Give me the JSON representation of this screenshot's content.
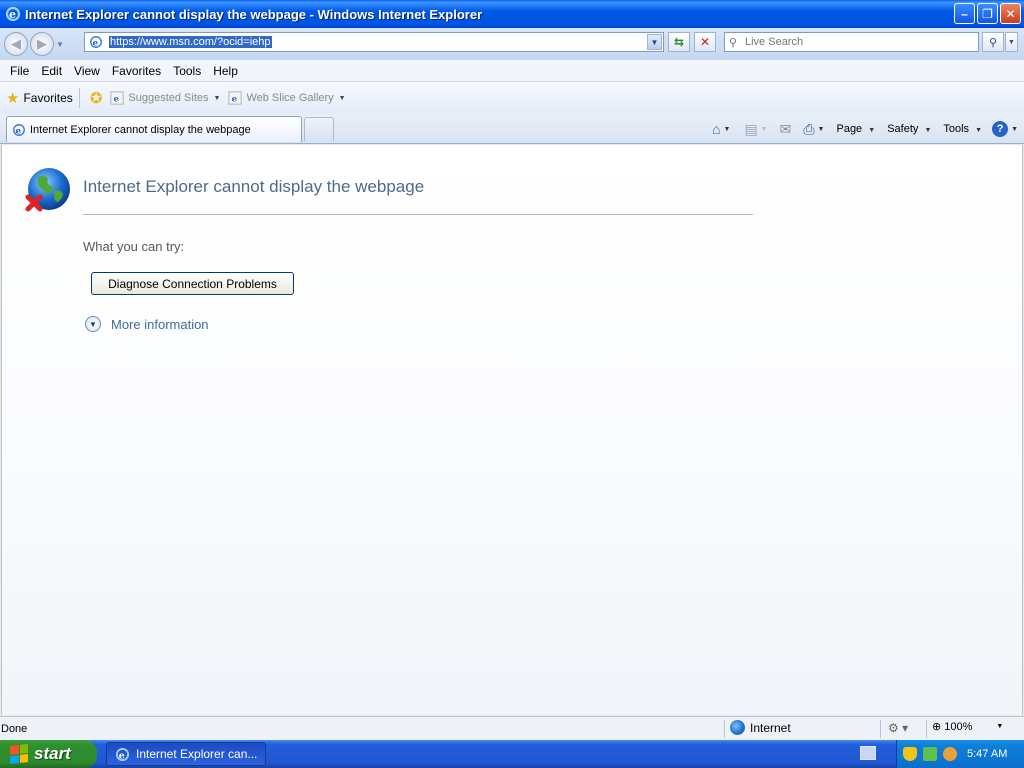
{
  "window": {
    "title": "Internet Explorer cannot display the webpage - Windows Internet Explorer",
    "controls": {
      "minimize": "–",
      "restore": "❐",
      "close": "✕"
    }
  },
  "address_bar": {
    "url": "https://www.msn.com/?ocid=iehp",
    "search_placeholder": "Live Search"
  },
  "menu": [
    "File",
    "Edit",
    "View",
    "Favorites",
    "Tools",
    "Help"
  ],
  "favorites_bar": {
    "favorites_label": "Favorites",
    "links": [
      "Suggested Sites",
      "Web Slice Gallery"
    ]
  },
  "tabs": [
    {
      "label": "Internet Explorer cannot display the webpage"
    }
  ],
  "command_bar": {
    "page": "Page",
    "safety": "Safety",
    "tools": "Tools"
  },
  "content": {
    "title": "Internet Explorer cannot display the webpage",
    "what_you_can_try": "What you can try:",
    "diagnose_button": "Diagnose Connection Problems",
    "more_information": "More information"
  },
  "status_bar": {
    "status": "Done",
    "zone": "Internet",
    "zoom": "100%"
  },
  "taskbar": {
    "start": "start",
    "task_button": "Internet Explorer can...",
    "clock": "5:47 AM"
  },
  "icons": {
    "app": "ie-logo-icon",
    "error": "globe-error-icon"
  },
  "colors": {
    "title_bar": "#0058e6",
    "content_title": "#4c6a8c",
    "link": "#3f6c9a",
    "start_button": "#2f8f2f",
    "selection": "#316ac5"
  }
}
